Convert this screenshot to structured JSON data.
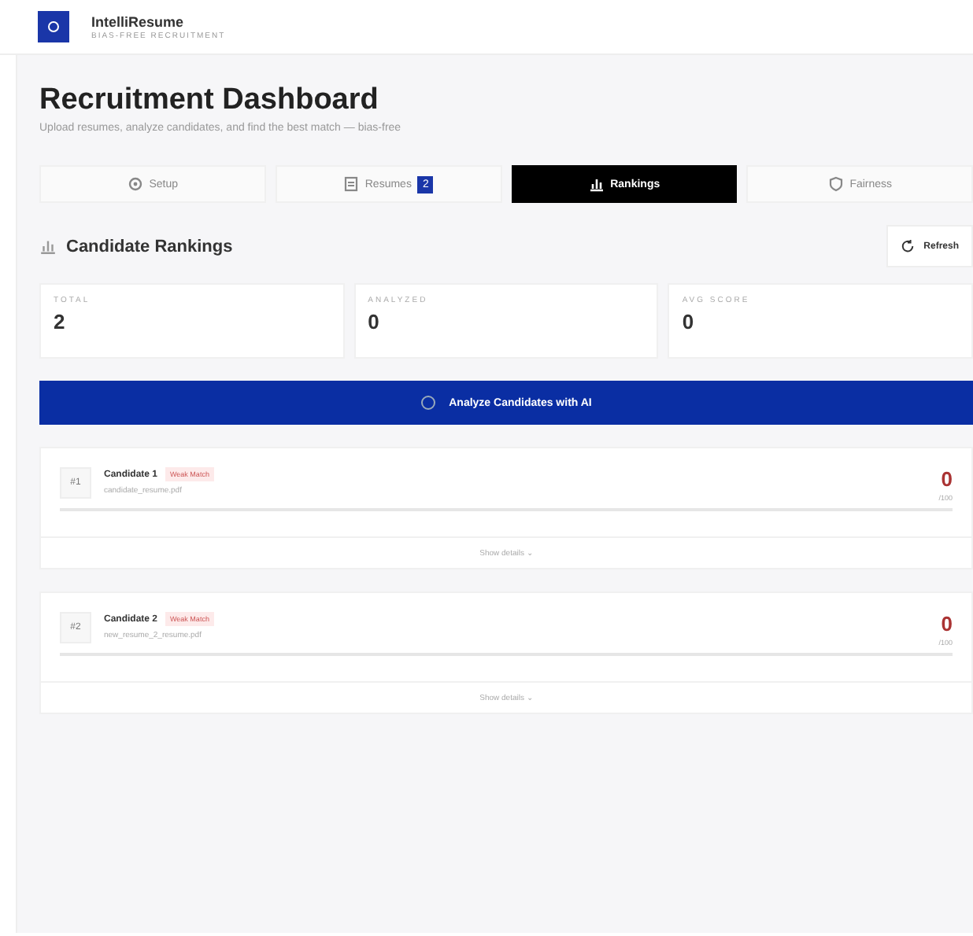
{
  "brand": {
    "name": "IntelliResume",
    "tagline": "BIAS-FREE RECRUITMENT"
  },
  "header": {
    "title": "Recruitment Dashboard",
    "subtitle": "Upload resumes, analyze candidates, and find the best match — bias-free"
  },
  "tabs": [
    {
      "label": "Setup",
      "selected": false
    },
    {
      "label": "Resumes",
      "selected": false,
      "badge": "2"
    },
    {
      "label": "Rankings",
      "selected": true
    },
    {
      "label": "Fairness",
      "selected": false
    }
  ],
  "section": {
    "title": "Candidate Rankings",
    "refresh": "Refresh"
  },
  "stats": [
    {
      "label": "TOTAL",
      "value": "2"
    },
    {
      "label": "ANALYZED",
      "value": "0"
    },
    {
      "label": "AVG SCORE",
      "value": "0"
    }
  ],
  "analyze_button": "Analyze Candidates with AI",
  "candidates": [
    {
      "rank": "#1",
      "name": "Candidate 1",
      "tag": "Weak Match",
      "file": "candidate_resume.pdf",
      "score": "0",
      "out_of": "/100",
      "details": "Show details ⌄"
    },
    {
      "rank": "#2",
      "name": "Candidate 2",
      "tag": "Weak Match",
      "file": "new_resume_2_resume.pdf",
      "score": "0",
      "out_of": "/100",
      "details": "Show details ⌄"
    }
  ]
}
